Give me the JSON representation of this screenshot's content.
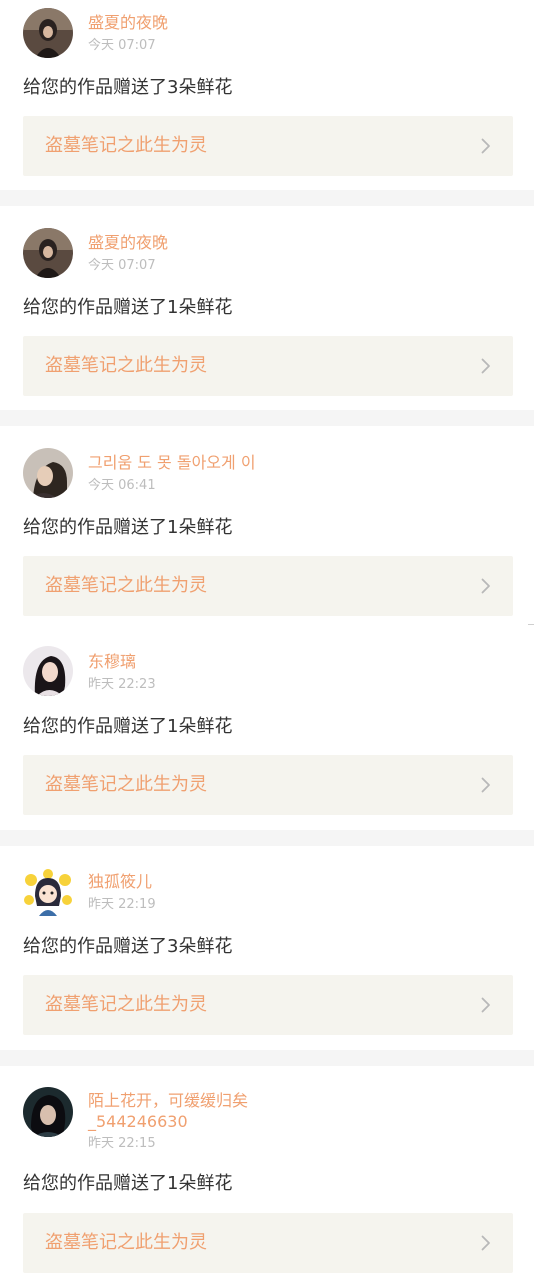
{
  "notifications": [
    {
      "user": "盛夏的夜晚",
      "time": "今天 07:07",
      "message": "给您的作品赠送了3朵鲜花",
      "work_title": "盗墓笔记之此生为灵",
      "avatar": "dark-portrait-avatar"
    },
    {
      "user": "盛夏的夜晚",
      "time": "今天 07:07",
      "message": "给您的作品赠送了1朵鲜花",
      "work_title": "盗墓笔记之此生为灵",
      "avatar": "dark-portrait-avatar"
    },
    {
      "user": "그리움 도 못 돌아오게 이",
      "time": "今天 06:41",
      "message": "给您的作品赠送了1朵鲜花",
      "work_title": "盗墓笔记之此生为灵",
      "avatar": "profile-portrait-avatar"
    },
    {
      "user": "东穆璃",
      "time": "昨天 22:23",
      "message": "给您的作品赠送了1朵鲜花",
      "work_title": "盗墓笔记之此生为灵",
      "avatar": "girl-portrait-avatar"
    },
    {
      "user": "独孤筱儿",
      "time": "昨天 22:19",
      "message": "给您的作品赠送了3朵鲜花",
      "work_title": "盗墓笔记之此生为灵",
      "avatar": "cartoon-girl-avatar"
    },
    {
      "user": "陌上花开，可缓缓归矣_544246630",
      "time": "昨天 22:15",
      "message": "给您的作品赠送了1朵鲜花",
      "work_title": "盗墓笔记之此生为灵",
      "avatar": "dark-hair-avatar"
    }
  ],
  "colors": {
    "accent": "#f0a070",
    "text": "#333333",
    "muted": "#bdbdbd",
    "work_bg": "#f5f4ee",
    "separator": "#f5f5f5"
  }
}
